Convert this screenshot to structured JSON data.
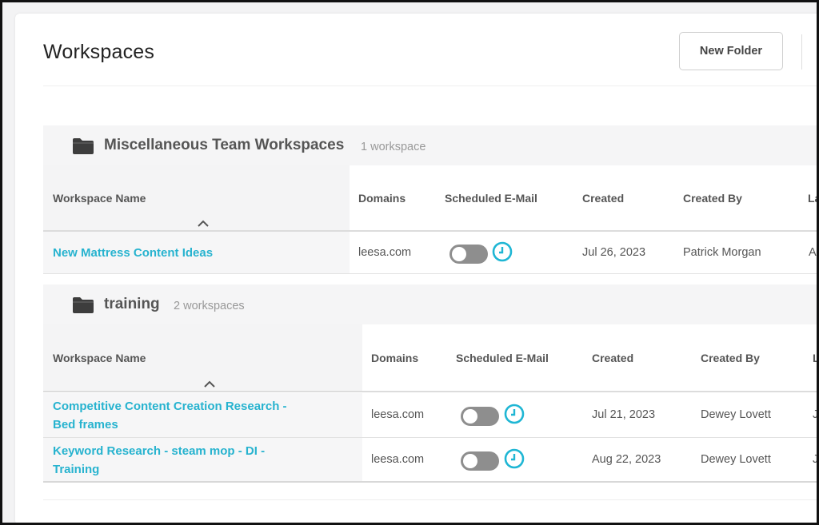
{
  "page": {
    "title": "Workspaces"
  },
  "toolbar": {
    "new_folder_label": "New Folder"
  },
  "columns": {
    "workspace_name": "Workspace Name",
    "domains": "Domains",
    "scheduled_email": "Scheduled E-Mail",
    "created": "Created",
    "created_by": "Created By",
    "cut_header": "La",
    "cut_header2": "L"
  },
  "folders": [
    {
      "name": "Miscellaneous Team Workspaces",
      "count": "1 workspace",
      "rows": [
        {
          "name_line1": "New Mattress Content Ideas",
          "name_line2": "",
          "domain": "leesa.com",
          "scheduled": false,
          "created": "Jul 26, 2023",
          "created_by": "Patrick Morgan",
          "cut": "A"
        }
      ]
    },
    {
      "name": "training",
      "count": "2 workspaces",
      "rows": [
        {
          "name_line1": "Competitive Content Creation Research -",
          "name_line2": "Bed frames",
          "domain": "leesa.com",
          "scheduled": false,
          "created": "Jul 21, 2023",
          "created_by": "Dewey Lovett",
          "cut": "J"
        },
        {
          "name_line1": "Keyword Research - steam mop - DI -",
          "name_line2": "Training",
          "domain": "leesa.com",
          "scheduled": false,
          "created": "Aug 22, 2023",
          "created_by": "Dewey Lovett",
          "cut": "J"
        }
      ]
    }
  ],
  "colors": {
    "link": "#27b3cf",
    "toggle_off": "#8e8e8e",
    "accent_clock": "#1fb6d4"
  }
}
